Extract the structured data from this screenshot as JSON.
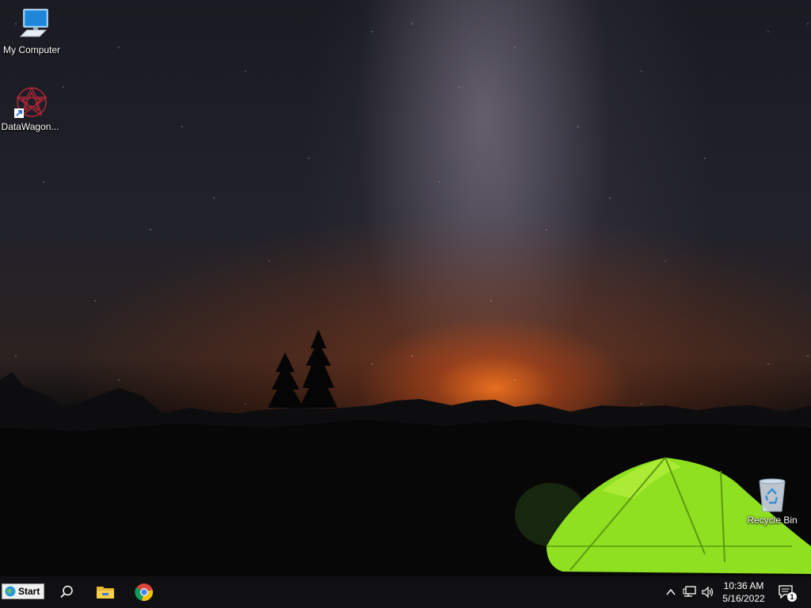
{
  "desktop": {
    "icons": [
      {
        "label": "My Computer"
      },
      {
        "label": "DataWagon..."
      },
      {
        "label": "Recycle Bin"
      }
    ]
  },
  "taskbar": {
    "start_label": "Start",
    "pinned": [
      "search-icon",
      "file-explorer-icon",
      "chrome-icon"
    ],
    "tray": [
      "chevron-up-icon",
      "network-icon",
      "volume-icon"
    ],
    "clock": {
      "time": "10:36 AM",
      "date": "5/16/2022"
    },
    "notifications": {
      "count": "1"
    }
  },
  "colors": {
    "taskbar_bg": "#101012",
    "tent_green": "#8fe020",
    "horizon_glow": "#ff7a1e"
  }
}
